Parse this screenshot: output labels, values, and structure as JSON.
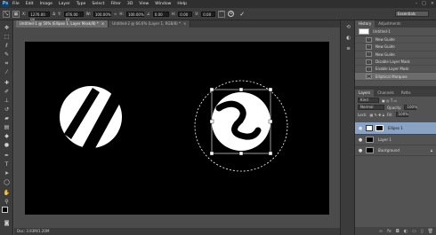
{
  "app": {
    "logo": "Ps"
  },
  "menu": [
    "File",
    "Edit",
    "Image",
    "Layer",
    "Type",
    "Select",
    "Filter",
    "3D",
    "View",
    "Window",
    "Help"
  ],
  "window_controls": [
    "–",
    "□",
    "×"
  ],
  "options_bar": {
    "x_value": "1276.00 px",
    "y_value": "476.00 px",
    "w_value": "100.00%",
    "h_value": "100.00%",
    "angle_value": "0.00",
    "hskew_value": "0.00",
    "vskew_value": "0.00",
    "workspace": "Essentials"
  },
  "tabs": [
    {
      "label": "Untitled-1 @ 50% (Ellipse 1, Layer Mask/8) *",
      "active": true
    },
    {
      "label": "Untitled-2 @ 66.6% (Layer 1, RGB/8) *",
      "active": false
    }
  ],
  "history": {
    "tabs": [
      "History",
      "Adjustments"
    ],
    "snapshot": "Untitled-1",
    "items": [
      "New Guide",
      "New Guide",
      "New Guide",
      "Disable Layer Mask",
      "Enable Layer Mask",
      "Elliptical Marquee"
    ]
  },
  "layers_panel": {
    "tabs": [
      "Layers",
      "Channels",
      "Paths"
    ],
    "kind_filter": "Kind",
    "blend_mode": "Normal",
    "opacity_label": "Opacity:",
    "opacity_value": "100%",
    "lock_label": "Lock:",
    "fill_label": "Fill:",
    "fill_value": "100%",
    "layers": [
      {
        "name": "Ellipse 1",
        "selected": true
      },
      {
        "name": "Layer 1",
        "selected": false
      },
      {
        "name": "Background",
        "selected": false
      }
    ]
  },
  "status": {
    "text": "Doc: 3.93M/1.20M"
  }
}
